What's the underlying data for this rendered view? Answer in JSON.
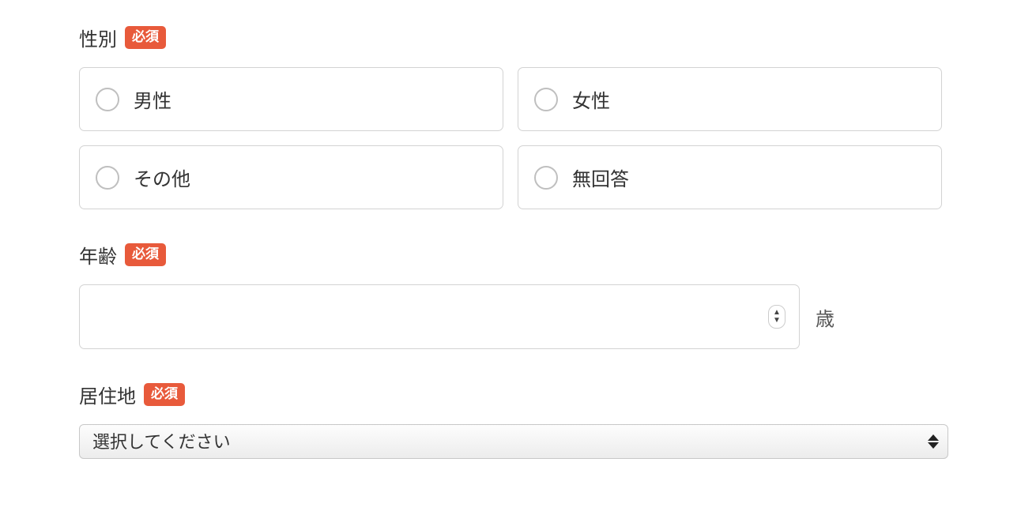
{
  "badges": {
    "required": "必須"
  },
  "gender": {
    "label": "性別",
    "options": [
      "男性",
      "女性",
      "その他",
      "無回答"
    ]
  },
  "age": {
    "label": "年齢",
    "unit": "歳",
    "value": ""
  },
  "residence": {
    "label": "居住地",
    "selected": "選択してください"
  }
}
